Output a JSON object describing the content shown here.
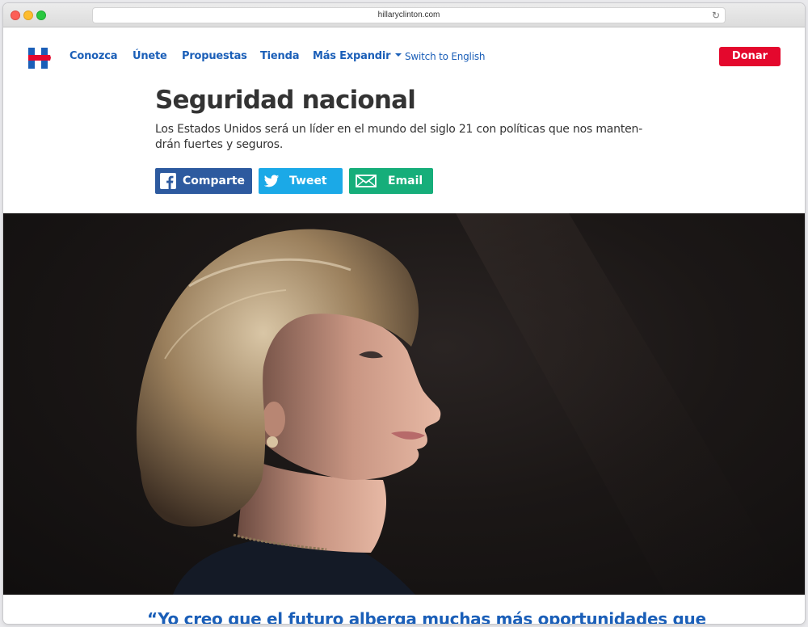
{
  "browser": {
    "url": "hillaryclinton.com"
  },
  "nav": {
    "items": [
      {
        "label": "Conozca"
      },
      {
        "label": "Únete"
      },
      {
        "label": "Propuestas"
      },
      {
        "label": "Tienda"
      },
      {
        "label": "Más Expandir"
      }
    ],
    "switch_label": "Switch to English",
    "donate_label": "Donar"
  },
  "page": {
    "title": "Seguridad nacional",
    "subtitle": "Los Estados Unidos será un líder en el mundo del siglo 21 con políticas que nos manten-drán fuertes y seguros.",
    "quote": "“Yo creo que el futuro alberga muchas más oportunidades que"
  },
  "share": {
    "facebook_label": "Comparte",
    "twitter_label": "Tweet",
    "email_label": "Email"
  },
  "icons": {
    "logo": "hillary-h-logo",
    "facebook": "facebook-icon",
    "twitter": "twitter-icon",
    "email": "email-icon",
    "reload": "reload-icon",
    "dropdown": "chevron-down-icon"
  },
  "colors": {
    "brand_blue": "#1b5fb8",
    "donate_red": "#e4082d",
    "facebook": "#2d5a9f",
    "twitter": "#1ba9e7",
    "email": "#16ae7a",
    "text": "#333333"
  }
}
